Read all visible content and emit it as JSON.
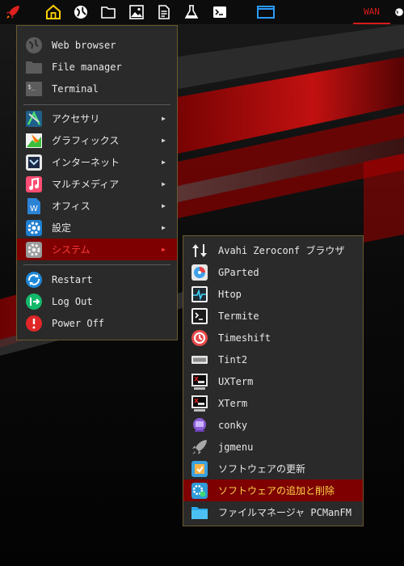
{
  "panel": {
    "icons": [
      "rocket-icon",
      "home-icon",
      "globe-icon",
      "folder-icon",
      "image-icon",
      "document-icon",
      "flask-icon",
      "terminal-icon",
      "window-icon"
    ],
    "wan_label": "WAN"
  },
  "main_menu": {
    "top_items": [
      {
        "label": "Web browser",
        "icon": "globe-icon"
      },
      {
        "label": "File manager",
        "icon": "folder-icon"
      },
      {
        "label": "Terminal",
        "icon": "terminal-icon"
      }
    ],
    "categories": [
      {
        "label": "アクセサリ",
        "icon": "accessories-icon",
        "has_submenu": true
      },
      {
        "label": "グラフィックス",
        "icon": "graphics-icon",
        "has_submenu": true
      },
      {
        "label": "インターネット",
        "icon": "internet-icon",
        "has_submenu": true
      },
      {
        "label": "マルチメディア",
        "icon": "multimedia-icon",
        "has_submenu": true
      },
      {
        "label": "オフィス",
        "icon": "office-icon",
        "has_submenu": true
      },
      {
        "label": "設定",
        "icon": "settings-icon",
        "has_submenu": true
      },
      {
        "label": "システム",
        "icon": "system-icon",
        "has_submenu": true,
        "active": true
      }
    ],
    "session_items": [
      {
        "label": "Restart",
        "icon": "restart-icon"
      },
      {
        "label": "Log Out",
        "icon": "logout-icon"
      },
      {
        "label": "Power Off",
        "icon": "power-icon"
      }
    ],
    "arrow": "▶"
  },
  "system_submenu": {
    "items": [
      {
        "label": "Avahi Zeroconf ブラウザ",
        "icon": "avahi-icon"
      },
      {
        "label": "GParted",
        "icon": "gparted-icon"
      },
      {
        "label": "Htop",
        "icon": "htop-icon"
      },
      {
        "label": "Termite",
        "icon": "termite-icon"
      },
      {
        "label": "Timeshift",
        "icon": "timeshift-icon"
      },
      {
        "label": "Tint2",
        "icon": "tint2-icon"
      },
      {
        "label": "UXTerm",
        "icon": "uxterm-icon"
      },
      {
        "label": "XTerm",
        "icon": "xterm-icon"
      },
      {
        "label": "conky",
        "icon": "conky-icon"
      },
      {
        "label": "jgmenu",
        "icon": "jgmenu-icon"
      },
      {
        "label": "ソフトウェアの更新",
        "icon": "software-update-icon"
      },
      {
        "label": "ソフトウェアの追加と削除",
        "icon": "software-add-remove-icon",
        "active": true
      },
      {
        "label": "ファイルマネージャ PCManFM",
        "icon": "pcmanfm-icon"
      }
    ]
  },
  "colors": {
    "accent_red": "#d81b1b",
    "active_bg": "#7e0000",
    "active_text": "#ff3b3b",
    "home_yellow": "#ffd000",
    "menu_bg": "#2a2a2a",
    "menu_border": "#6b5a2e"
  }
}
